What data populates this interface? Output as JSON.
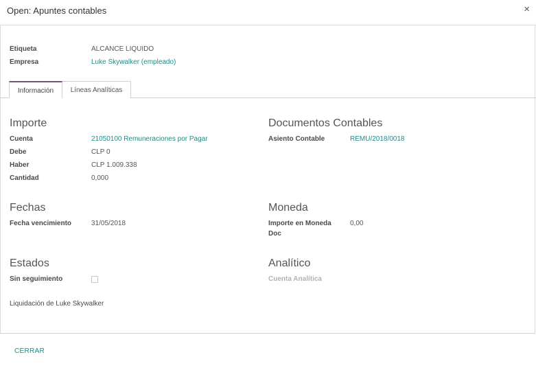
{
  "dialog": {
    "title": "Open: Apuntes contables",
    "close_glyph": "×"
  },
  "top_fields": {
    "etiqueta_label": "Etiqueta",
    "etiqueta_value": "ALCANCE LIQUIDO",
    "empresa_label": "Empresa",
    "empresa_value": "Luke Skywalker (empleado)"
  },
  "tabs": [
    {
      "label": "Información"
    },
    {
      "label": "Líneas Analíticas"
    }
  ],
  "importe": {
    "heading": "Importe",
    "cuenta_label": "Cuenta",
    "cuenta_value": "21050100 Remuneraciones por Pagar",
    "debe_label": "Debe",
    "debe_value": "CLP 0",
    "haber_label": "Haber",
    "haber_value": "CLP 1.009.338",
    "cantidad_label": "Cantidad",
    "cantidad_value": "0,000"
  },
  "documentos": {
    "heading": "Documentos Contables",
    "asiento_label": "Asiento Contable",
    "asiento_value": "REMU/2018/0018"
  },
  "fechas": {
    "heading": "Fechas",
    "vencimiento_label": "Fecha vencimiento",
    "vencimiento_value": "31/05/2018"
  },
  "moneda": {
    "heading": "Moneda",
    "importe_moneda_label_1": "Importe en Moneda",
    "importe_moneda_label_2": "Doc",
    "importe_moneda_value": "0,00"
  },
  "estados": {
    "heading": "Estados",
    "sin_seguimiento_label": "Sin seguimiento",
    "sin_seguimiento_checked": false
  },
  "analitico": {
    "heading": "Analítico",
    "cuenta_analitica_label": "Cuenta Analítica"
  },
  "note": "Liquidación de Luke Skywalker",
  "footer": {
    "cerrar_label": "CERRAR"
  },
  "colors": {
    "link": "#1f8b86",
    "active_tab": "#7c4d7a"
  }
}
